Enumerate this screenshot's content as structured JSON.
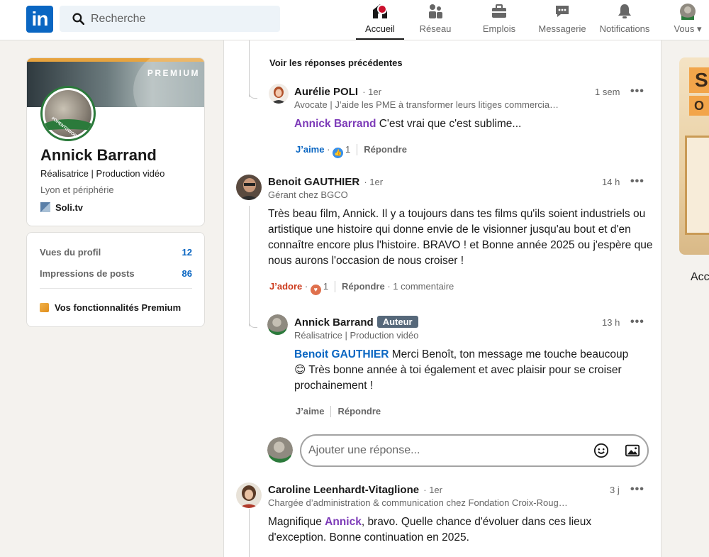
{
  "nav": {
    "logo": "in",
    "search_placeholder": "Recherche",
    "items": [
      {
        "label": "Accueil"
      },
      {
        "label": "Réseau"
      },
      {
        "label": "Emplois"
      },
      {
        "label": "Messagerie"
      },
      {
        "label": "Notifications"
      },
      {
        "label": "Vous ▾"
      }
    ]
  },
  "profile": {
    "premium_label": "PREMIUM",
    "badge_text": "#OPENTOWORK",
    "name": "Annick Barrand",
    "headline": "Réalisatrice | Production vidéo",
    "location": "Lyon et périphérie",
    "company": "Soli.tv"
  },
  "stats": {
    "views_label": "Vues du profil",
    "views_value": "12",
    "impressions_label": "Impressions de posts",
    "impressions_value": "86",
    "premium_features": "Vos fonctionnalités Premium"
  },
  "feed": {
    "previous_replies": "Voir les réponses précédentes",
    "comments": [
      {
        "name": "Aurélie POLI",
        "degree": "· 1er",
        "headline": "Avocate | J’aide les PME à transformer leurs litiges commercia…",
        "time": "1 sem",
        "more": "•••",
        "mention": "Annick Barrand",
        "text": " C'est vrai que c'est sublime...",
        "reaction_label": "J’aime",
        "reaction_count": "1",
        "reply_label": "Répondre"
      },
      {
        "name": "Benoit GAUTHIER",
        "degree": "· 1er",
        "headline": "Gérant chez BGCO",
        "time": "14 h",
        "more": "•••",
        "text": "Très beau film, Annick. Il y a toujours dans tes films qu'ils soient industriels ou artistique une histoire qui donne envie de le visionner jusqu'au bout et d'en connaître encore plus l'histoire. BRAVO ! et Bonne année 2025 ou j'espère que nous aurons l'occasion de nous croiser !",
        "reaction_label": "J’adore",
        "reaction_count": "1",
        "reply_label": "Répondre",
        "comments_count": "· 1 commentaire"
      },
      {
        "name": "Annick Barrand",
        "author_badge": "Auteur",
        "headline": "Réalisatrice | Production vidéo",
        "time": "13 h",
        "more": "•••",
        "mention": "Benoit GAUTHIER",
        "text_line1": " Merci Benoît, ton message me touche beaucoup",
        "emoji": "😊",
        "text_line2": " Très bonne année à toi également et avec plaisir pour se croiser prochainement !",
        "like_label": "J’aime",
        "reply_label": "Répondre"
      },
      {
        "name": "Caroline Leenhardt-Vitaglione",
        "degree": "· 1er",
        "headline": "Chargée d’administration & communication chez Fondation Croix-Roug…",
        "time": "3 j",
        "more": "•••",
        "text_before": "Magnifique ",
        "mention": "Annick",
        "text_after": ", bravo. Quelle chance d'évoluer dans ces lieux d'exception. Bonne continuation en 2025."
      }
    ],
    "reply_placeholder": "Ajouter une réponse..."
  },
  "ad": {
    "tag_a": "S",
    "tag_b": "O",
    "text": "Acc"
  },
  "colors": {
    "brand": "#0a66c2",
    "mention_purple": "#7d3bb8",
    "love_red": "#cc3a1c",
    "open_to_work_green": "#2b7a3b"
  }
}
